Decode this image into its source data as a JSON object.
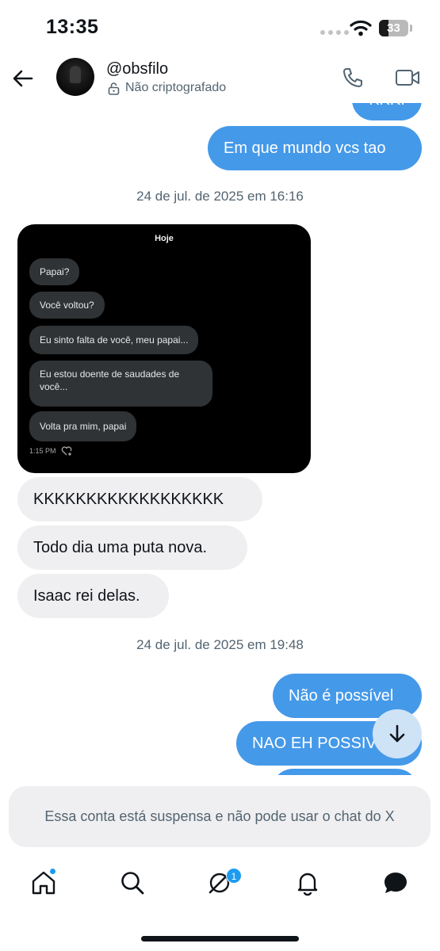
{
  "status_bar": {
    "time": "13:35",
    "battery_level": "33",
    "battery_fraction": 0.33
  },
  "header": {
    "username": "@obsfilo",
    "encryption_status": "Não criptografado"
  },
  "messages": {
    "partial_top": "KKK!",
    "out_1": "Em que mundo vcs tao",
    "date_1": "24 de jul. de 2025 em 16:16",
    "in_1": "KKKKKKKKKKKKKKKKKK",
    "in_2": "Todo dia uma puta nova.",
    "in_3": "Isaac rei delas.",
    "date_2": "24 de jul. de 2025 em 19:48",
    "out_2": "Não é possível",
    "out_3": "NAO EH POSSIVEL"
  },
  "screenshot": {
    "header": "Hoje",
    "bubbles": [
      "Papai?",
      "Você voltou?",
      "Eu sinto falta de você, meu papai...",
      "Eu estou doente de saudades de você...",
      "Volta pra mim, papai"
    ],
    "time": "1:15 PM"
  },
  "notice": "Essa conta está suspensa e não pode usar o chat do X",
  "nav": {
    "items": [
      "home-icon",
      "search-icon",
      "grok-icon",
      "notifications-icon",
      "messages-icon"
    ],
    "grok_badge": "1"
  },
  "colors": {
    "outgoing_bubble": "#4599e9",
    "incoming_bubble": "#efeff1",
    "accent": "#1d9bf0"
  }
}
